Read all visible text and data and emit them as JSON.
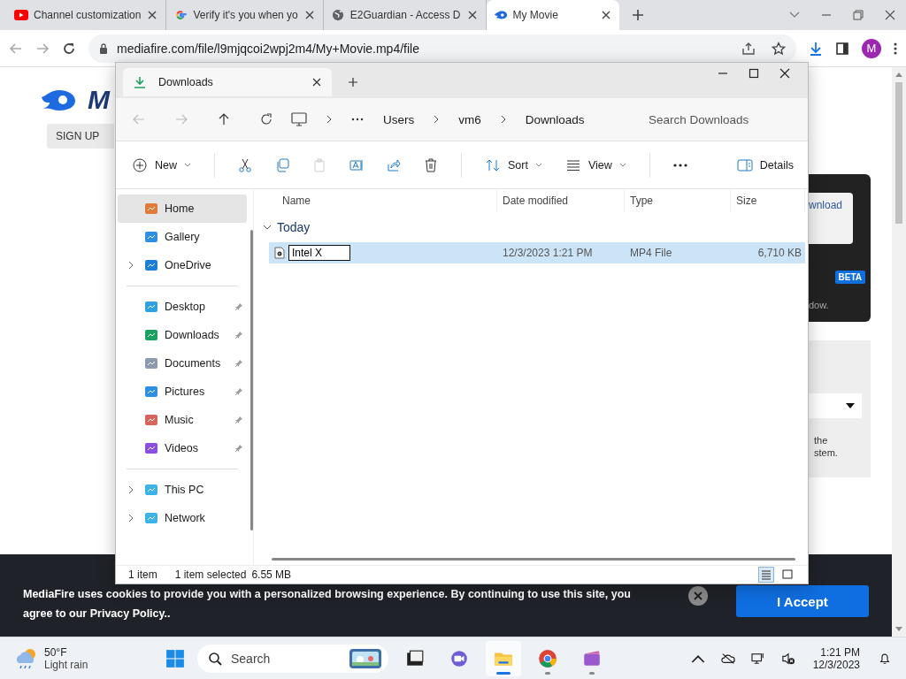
{
  "browser": {
    "tabs": [
      {
        "title": "Channel customization",
        "selected": false
      },
      {
        "title": "Verify it's you when yo",
        "selected": false
      },
      {
        "title": "E2Guardian - Access D",
        "selected": false
      },
      {
        "title": "My Movie",
        "selected": true
      }
    ],
    "url": "mediafire.com/file/l9mjqcoi2wpj2m4/My+Movie.mp4/file",
    "profile": "M"
  },
  "page": {
    "logo_text": "M",
    "sign_up": "SIGN UP",
    "download_fragment": "wnload",
    "beta": "BETA",
    "panel_fragment": "dow.",
    "note_fragments": [
      "the",
      "stem."
    ],
    "cookie": {
      "text": "MediaFire uses cookies to provide you with a personalized browsing experience. By continuing to use this site, you agree to our Privacy Policy..",
      "accept": "I Accept"
    }
  },
  "explorer": {
    "tab_title": "Downloads",
    "breadcrumb": [
      "Users",
      "vm6",
      "Downloads"
    ],
    "search": {
      "placeholder": "Search Downloads"
    },
    "commands": {
      "new": "New",
      "sort": "Sort",
      "view": "View",
      "details": "Details"
    },
    "sidebar": [
      [
        {
          "label": "Home",
          "selected": true,
          "expandable": false,
          "pinned": false
        },
        {
          "label": "Gallery",
          "selected": false,
          "expandable": false,
          "pinned": false
        },
        {
          "label": "OneDrive",
          "selected": false,
          "expandable": true,
          "pinned": false
        }
      ],
      [
        {
          "label": "Desktop",
          "selected": false,
          "expandable": false,
          "pinned": true
        },
        {
          "label": "Downloads",
          "selected": false,
          "expandable": false,
          "pinned": true
        },
        {
          "label": "Documents",
          "selected": false,
          "expandable": false,
          "pinned": true
        },
        {
          "label": "Pictures",
          "selected": false,
          "expandable": false,
          "pinned": true
        },
        {
          "label": "Music",
          "selected": false,
          "expandable": false,
          "pinned": true
        },
        {
          "label": "Videos",
          "selected": false,
          "expandable": false,
          "pinned": true
        }
      ],
      [
        {
          "label": "This PC",
          "selected": false,
          "expandable": true,
          "pinned": false
        },
        {
          "label": "Network",
          "selected": false,
          "expandable": true,
          "pinned": false
        }
      ]
    ],
    "columns": [
      "Name",
      "Date modified",
      "Type",
      "Size"
    ],
    "group": {
      "label": "Today",
      "expanded": true
    },
    "files": [
      {
        "name": "Intel X",
        "date": "12/3/2023 1:21 PM",
        "type": "MP4 File",
        "size": "6,710 KB",
        "selected": true,
        "renaming": true
      }
    ],
    "status": {
      "count": "1 item",
      "selection": "1 item selected",
      "size": "6.55 MB",
      "details_view": true
    }
  },
  "taskbar": {
    "temperature": "50°F",
    "weather": "Light rain",
    "search": "Search",
    "apps": [
      {
        "running": false,
        "active": false
      },
      {
        "running": false,
        "active": false
      },
      {
        "running": true,
        "active": true
      },
      {
        "running": true,
        "active": false
      },
      {
        "running": true,
        "active": false
      }
    ],
    "time": "1:21 PM",
    "date": "12/3/2023"
  }
}
